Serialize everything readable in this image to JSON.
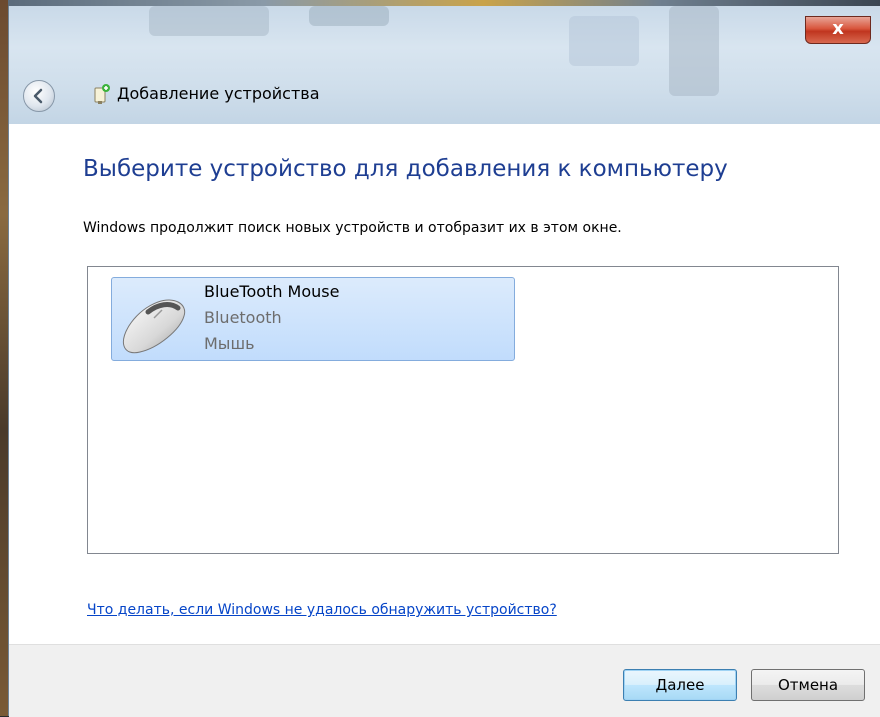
{
  "window": {
    "title": "Добавление устройства",
    "close_label": "x"
  },
  "content": {
    "heading": "Выберите устройство для добавления к компьютеру",
    "description": "Windows продолжит поиск новых устройств и отобразит их в этом окне.",
    "devices": [
      {
        "name": "BlueTooth Mouse",
        "type": "Bluetooth",
        "category": "Мышь",
        "icon": "mouse-icon",
        "selected": true
      }
    ],
    "help_link": "Что делать, если Windows не удалось обнаружить устройство?"
  },
  "footer": {
    "next_label": "Далее",
    "cancel_label": "Отмена"
  },
  "colors": {
    "heading": "#1e3e92",
    "link": "#0645c8",
    "selection": "#c1dcfc",
    "close": "#c0351f"
  }
}
